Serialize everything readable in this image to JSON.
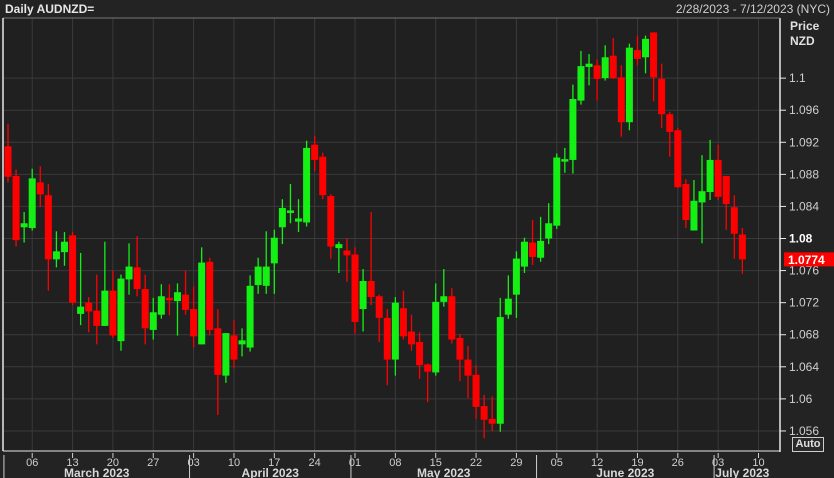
{
  "header": {
    "title": "Daily AUDNZD=",
    "date_range": "2/28/2023 - 7/12/2023 (NYC)"
  },
  "axis": {
    "price_label": "Price",
    "currency_label": "NZD",
    "auto_button": "Auto"
  },
  "colors": {
    "up": "#14f014",
    "down": "#ff0000",
    "last_price_bg": "#ff0000"
  },
  "chart_data": {
    "type": "candlestick",
    "title": "Daily AUDNZD=",
    "ylim": [
      1.0535,
      1.1075
    ],
    "yticks": [
      "1.056",
      "1.06",
      "1.064",
      "1.068",
      "1.072",
      "1.076",
      "1.08",
      "1.084",
      "1.088",
      "1.092",
      "1.096",
      "1.1"
    ],
    "xticks": [
      "06",
      "13",
      "20",
      "27",
      "03",
      "10",
      "17",
      "24",
      "01",
      "08",
      "15",
      "22",
      "29",
      "05",
      "12",
      "19",
      "26",
      "03",
      "10"
    ],
    "xtick_index": [
      3,
      8,
      13,
      18,
      23,
      28,
      33,
      38,
      43,
      48,
      53,
      58,
      63,
      68,
      73,
      78,
      83,
      88,
      93
    ],
    "months": [
      {
        "label": "March 2023",
        "start": -1,
        "end": 22
      },
      {
        "label": "April 2023",
        "start": 22,
        "end": 42
      },
      {
        "label": "May 2023",
        "start": 42,
        "end": 65
      },
      {
        "label": "June 2023",
        "start": 65,
        "end": 87
      },
      {
        "label": "July 2023",
        "start": 87,
        "end": 94
      }
    ],
    "last_price": "1.0774",
    "grid": true,
    "ohlc": [
      [
        1.0915,
        1.0943,
        1.087,
        1.0877
      ],
      [
        1.0878,
        1.0886,
        1.079,
        1.0798
      ],
      [
        1.0814,
        1.0833,
        1.0795,
        1.0819
      ],
      [
        1.0813,
        1.0887,
        1.081,
        1.0875
      ],
      [
        1.087,
        1.089,
        1.0839,
        1.0855
      ],
      [
        1.0854,
        1.0868,
        1.0735,
        1.0774
      ],
      [
        1.0774,
        1.0809,
        1.0764,
        1.0784
      ],
      [
        1.0783,
        1.0808,
        1.0766,
        1.0796
      ],
      [
        1.0804,
        1.0808,
        1.0717,
        1.072
      ],
      [
        1.0706,
        1.0782,
        1.0692,
        1.0715
      ],
      [
        1.072,
        1.0727,
        1.0683,
        1.0709
      ],
      [
        1.071,
        1.0755,
        1.0668,
        1.0691
      ],
      [
        1.0691,
        1.0796,
        1.0691,
        1.0735
      ],
      [
        1.0735,
        1.076,
        1.0676,
        1.0679
      ],
      [
        1.0672,
        1.0755,
        1.066,
        1.075
      ],
      [
        1.0749,
        1.0794,
        1.073,
        1.0765
      ],
      [
        1.0764,
        1.0803,
        1.0728,
        1.0737
      ],
      [
        1.0737,
        1.0755,
        1.0668,
        1.0688
      ],
      [
        1.0686,
        1.0726,
        1.0674,
        1.0708
      ],
      [
        1.0705,
        1.0743,
        1.07,
        1.0728
      ],
      [
        1.0726,
        1.0743,
        1.0704,
        1.0724
      ],
      [
        1.0722,
        1.0744,
        1.0679,
        1.0733
      ],
      [
        1.073,
        1.076,
        1.0705,
        1.0711
      ],
      [
        1.0712,
        1.074,
        1.0664,
        1.0678
      ],
      [
        1.0668,
        1.0789,
        1.0668,
        1.077
      ],
      [
        1.0771,
        1.0776,
        1.0679,
        1.0686
      ],
      [
        1.0688,
        1.0712,
        1.058,
        1.063
      ],
      [
        1.0629,
        1.0682,
        1.062,
        1.0682
      ],
      [
        1.0679,
        1.0698,
        1.0638,
        1.0649
      ],
      [
        1.0668,
        1.0688,
        1.0653,
        1.0673
      ],
      [
        1.0664,
        1.0754,
        1.0659,
        1.0741
      ],
      [
        1.0742,
        1.0776,
        1.0731,
        1.0765
      ],
      [
        1.0741,
        1.0809,
        1.0731,
        1.0765
      ],
      [
        1.0769,
        1.0811,
        1.0731,
        1.0801
      ],
      [
        1.0814,
        1.0849,
        1.0793,
        1.0838
      ],
      [
        1.0832,
        1.0868,
        1.0819,
        1.0835
      ],
      [
        1.0821,
        1.0849,
        1.0808,
        1.0825
      ],
      [
        1.082,
        1.0922,
        1.0815,
        1.0913
      ],
      [
        1.0917,
        1.0928,
        1.0884,
        1.0898
      ],
      [
        1.0902,
        1.0907,
        1.0849,
        1.0854
      ],
      [
        1.0853,
        1.0855,
        1.0775,
        1.079
      ],
      [
        1.0788,
        1.0796,
        1.0757,
        1.0793
      ],
      [
        1.0785,
        1.08,
        1.0746,
        1.0779
      ],
      [
        1.078,
        1.0789,
        1.0681,
        1.0696
      ],
      [
        1.0712,
        1.0762,
        1.0684,
        1.0747
      ],
      [
        1.0747,
        1.0833,
        1.0717,
        1.0727
      ],
      [
        1.0728,
        1.073,
        1.0671,
        1.0701
      ],
      [
        1.0701,
        1.0712,
        1.0617,
        1.0649
      ],
      [
        1.0649,
        1.0727,
        1.0629,
        1.072
      ],
      [
        1.0713,
        1.0735,
        1.0674,
        1.0678
      ],
      [
        1.0684,
        1.0705,
        1.066,
        1.0668
      ],
      [
        1.0671,
        1.0683,
        1.0625,
        1.0642
      ],
      [
        1.0643,
        1.0644,
        1.0596,
        1.0634
      ],
      [
        1.0633,
        1.0744,
        1.0629,
        1.0721
      ],
      [
        1.0721,
        1.0762,
        1.0715,
        1.0728
      ],
      [
        1.0728,
        1.0738,
        1.0669,
        1.0674
      ],
      [
        1.0676,
        1.0681,
        1.0622,
        1.0649
      ],
      [
        1.0649,
        1.0666,
        1.0601,
        1.0629
      ],
      [
        1.063,
        1.0642,
        1.0575,
        1.059
      ],
      [
        1.0591,
        1.0605,
        1.0551,
        1.0574
      ],
      [
        1.0575,
        1.0603,
        1.056,
        1.0569
      ],
      [
        1.0569,
        1.0726,
        1.0559,
        1.0702
      ],
      [
        1.0705,
        1.0754,
        1.07,
        1.0725
      ],
      [
        1.073,
        1.0784,
        1.0701,
        1.0775
      ],
      [
        1.0765,
        1.0801,
        1.0757,
        1.0796
      ],
      [
        1.0795,
        1.0823,
        1.0767,
        1.0777
      ],
      [
        1.0776,
        1.0827,
        1.0771,
        1.0797
      ],
      [
        1.08,
        1.0844,
        1.0793,
        1.0819
      ],
      [
        1.0816,
        1.0906,
        1.0812,
        1.0901
      ],
      [
        1.0896,
        1.0913,
        1.0882,
        1.0899
      ],
      [
        1.0898,
        1.0992,
        1.0881,
        1.0974
      ],
      [
        1.0972,
        1.1034,
        1.0967,
        1.1015
      ],
      [
        1.1014,
        1.103,
        1.0991,
        1.1018
      ],
      [
        1.1016,
        1.1023,
        1.0972,
        1.0999
      ],
      [
        1.1,
        1.1041,
        1.0997,
        1.1026
      ],
      [
        1.1028,
        1.105,
        1.0999,
        1.1
      ],
      [
        1.1001,
        1.1016,
        1.0927,
        1.0945
      ],
      [
        1.0945,
        1.1043,
        1.0935,
        1.1038
      ],
      [
        1.1035,
        1.1053,
        1.1016,
        1.1024
      ],
      [
        1.1026,
        1.1053,
        1.1006,
        1.1049
      ],
      [
        1.1057,
        1.1057,
        1.0971,
        1.1001
      ],
      [
        1.0999,
        1.1018,
        1.0938,
        1.0955
      ],
      [
        1.0955,
        1.0958,
        1.0902,
        1.0933
      ],
      [
        1.0935,
        1.0938,
        1.0863,
        1.0864
      ],
      [
        1.0868,
        1.0874,
        1.0813,
        1.0823
      ],
      [
        1.081,
        1.0873,
        1.081,
        1.0847
      ],
      [
        1.0845,
        1.0904,
        1.0794,
        1.0859
      ],
      [
        1.0858,
        1.0923,
        1.0848,
        1.0898
      ],
      [
        1.0898,
        1.0917,
        1.0848,
        1.0852
      ],
      [
        1.0878,
        1.0878,
        1.0811,
        1.0843
      ],
      [
        1.0839,
        1.0854,
        1.0775,
        1.0806
      ],
      [
        1.0805,
        1.0813,
        1.0756,
        1.0774
      ]
    ]
  }
}
